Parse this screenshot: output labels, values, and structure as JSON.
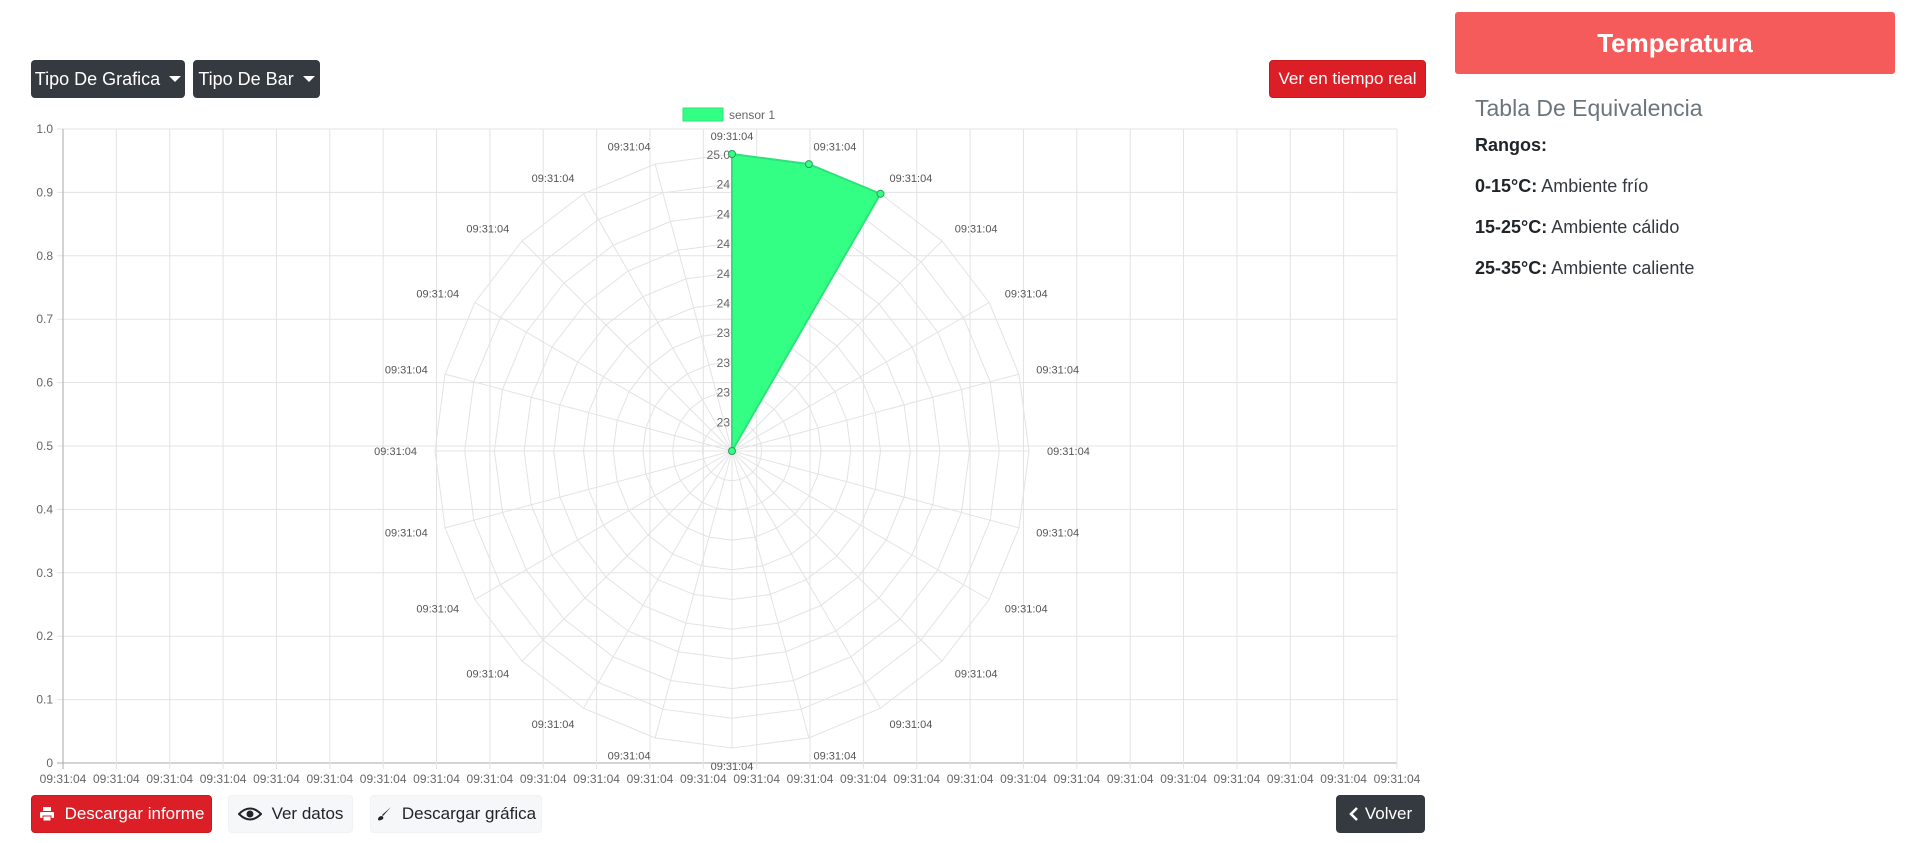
{
  "toolbar": {
    "chart_type_label": "Tipo De Grafica",
    "bar_type_label": "Tipo De Bar",
    "realtime_label": "Ver en tiempo real"
  },
  "footer": {
    "download_report_label": "Descargar informe",
    "view_data_label": "Ver datos",
    "download_chart_label": "Descargar gráfica",
    "back_label": "Volver"
  },
  "panel": {
    "title": "Temperatura",
    "equivalence_title": "Tabla De Equivalencia",
    "ranges_label": "Rangos:",
    "ranges": [
      {
        "range": "0-15°C:",
        "desc": "Ambiente frío"
      },
      {
        "range": "15-25°C:",
        "desc": "Ambiente cálido"
      },
      {
        "range": "25-35°C:",
        "desc": "Ambiente caliente"
      }
    ]
  },
  "colors": {
    "series_fill": "#33ff85",
    "series_stroke": "#2ee27a",
    "grid": "#e3e3e3",
    "panel_header": "#f55b5b",
    "button_red": "#dc1f26",
    "button_dark": "#343a40"
  },
  "chart_data": {
    "type": "polar-radar",
    "legend": {
      "position": "top",
      "labels": [
        "sensor 1"
      ]
    },
    "series": [
      {
        "name": "sensor 1",
        "points": [
          {
            "label": "09:31:04",
            "value": 25.0
          },
          {
            "label": "09:31:04",
            "value": 25.0
          },
          {
            "label": "09:31:04",
            "value": 25.0
          },
          {
            "label": "09:31:04",
            "value": 0
          }
        ]
      }
    ],
    "radial_labels": [
      "09:31:04",
      "09:31:04",
      "09:31:04",
      "09:31:04",
      "09:31:04",
      "09:31:04",
      "09:31:04",
      "09:31:04",
      "09:31:04",
      "09:31:04",
      "09:31:04",
      "09:31:04",
      "09:31:04",
      "09:31:04",
      "09:31:04",
      "09:31:04",
      "09:31:04",
      "09:31:04",
      "09:31:04",
      "09:31:04",
      "09:31:04",
      "09:31:04",
      "09:31:04",
      "09:31:04"
    ],
    "radial_tick_labels": [
      "25.0",
      "24",
      "24",
      "24",
      "24",
      "24",
      "23",
      "23",
      "23",
      "23"
    ],
    "x_tick_labels": [
      "09:31:04",
      "09:31:04",
      "09:31:04",
      "09:31:04",
      "09:31:04",
      "09:31:04",
      "09:31:04",
      "09:31:04",
      "09:31:04",
      "09:31:04",
      "09:31:04",
      "09:31:04",
      "09:31:04",
      "09:31:04",
      "09:31:04",
      "09:31:04",
      "09:31:04",
      "09:31:04",
      "09:31:04",
      "09:31:04",
      "09:31:04",
      "09:31:04",
      "09:31:04",
      "09:31:04",
      "09:31:04",
      "09:31:04"
    ],
    "y_tick_labels": [
      "0",
      "0.1",
      "0.2",
      "0.3",
      "0.4",
      "0.5",
      "0.6",
      "0.7",
      "0.8",
      "0.9",
      "1.0"
    ],
    "ylim": [
      0,
      1.0
    ],
    "grid": true
  }
}
